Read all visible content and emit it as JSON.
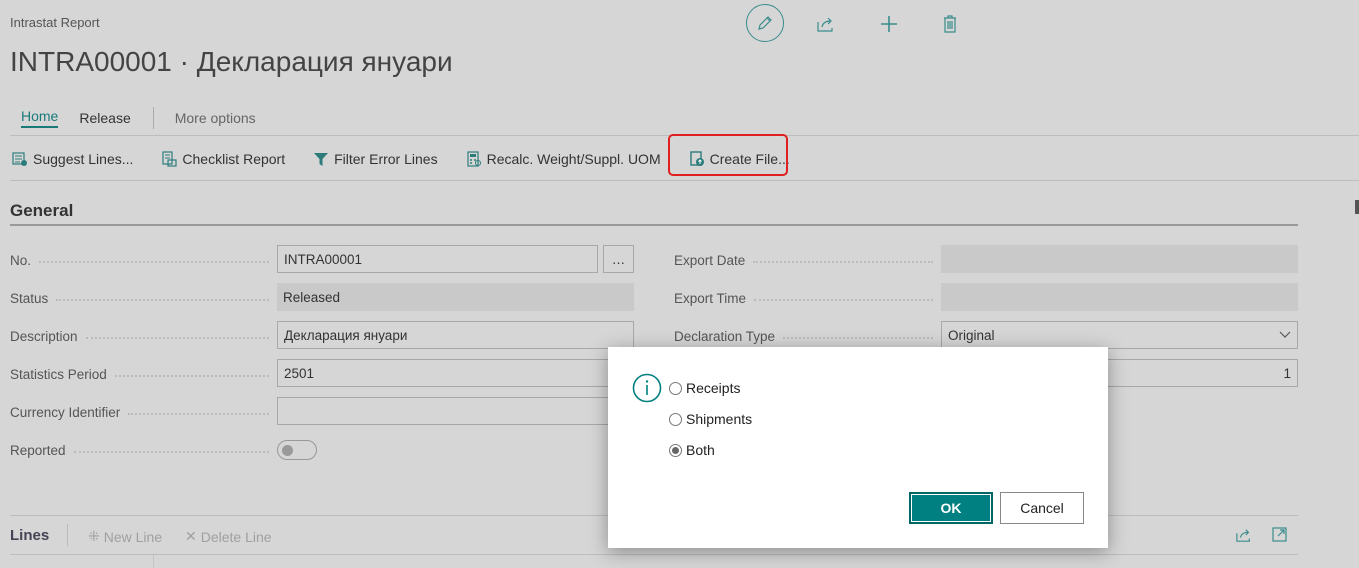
{
  "breadcrumb": "Intrastat Report",
  "title": "INTRA00001 · Декларация януари",
  "header_icons": [
    "edit-icon",
    "share-icon",
    "add-icon",
    "delete-icon"
  ],
  "tabs": [
    {
      "label": "Home",
      "active": true
    },
    {
      "label": "Release"
    },
    {
      "label": "More options"
    }
  ],
  "actions": [
    {
      "label": "Suggest Lines...",
      "icon": "suggest-lines-icon"
    },
    {
      "label": "Checklist Report",
      "icon": "report-icon"
    },
    {
      "label": "Filter Error Lines",
      "icon": "filter-icon"
    },
    {
      "label": "Recalc. Weight/Suppl. UOM",
      "icon": "calculator-icon"
    },
    {
      "label": "Create File...",
      "icon": "create-file-icon",
      "highlighted": true
    }
  ],
  "section": "General",
  "fields_left": [
    {
      "label": "No.",
      "value": "INTRA00001"
    },
    {
      "label": "Status",
      "value": "Released"
    },
    {
      "label": "Description",
      "value": "Декларация януари"
    },
    {
      "label": "Statistics Period",
      "value": "2501"
    },
    {
      "label": "Currency Identifier",
      "value": ""
    },
    {
      "label": "Reported",
      "value": "off"
    }
  ],
  "fields_right": [
    {
      "label": "Export Date",
      "value": ""
    },
    {
      "label": "Export Time",
      "value": ""
    },
    {
      "label": "Declaration Type",
      "value": "Original"
    },
    {
      "label": "",
      "value": "1"
    }
  ],
  "dialog": {
    "options": [
      {
        "label": "Receipts",
        "selected": false
      },
      {
        "label": "Shipments",
        "selected": false
      },
      {
        "label": "Both",
        "selected": true
      }
    ],
    "ok": "OK",
    "cancel": "Cancel"
  },
  "lines": {
    "title": "Lines",
    "new_line": "New Line",
    "delete_line": "Delete Line"
  },
  "colors": {
    "accent": "#008080",
    "highlight": "#e02020"
  }
}
